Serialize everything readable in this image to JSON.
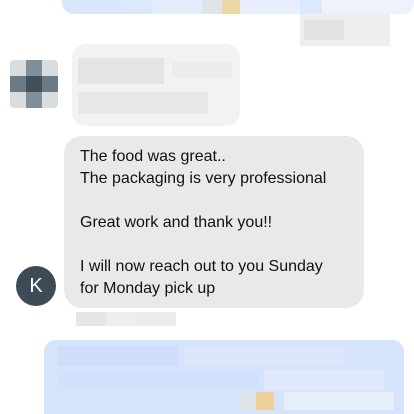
{
  "conversation": {
    "contact_initial": "K",
    "message": {
      "lines": [
        "The food was great..",
        "The packaging is very professional",
        "",
        "Great work and thank you!!",
        "",
        "I will now reach out to you Sunday",
        "for Monday pick up"
      ]
    },
    "colors": {
      "incoming_bubble": "#e9e9eb",
      "avatar_bg": "#3d4b57",
      "outgoing_bubble": "#dce8fb"
    },
    "icons": {
      "avatar": "contact-avatar-icon"
    }
  }
}
